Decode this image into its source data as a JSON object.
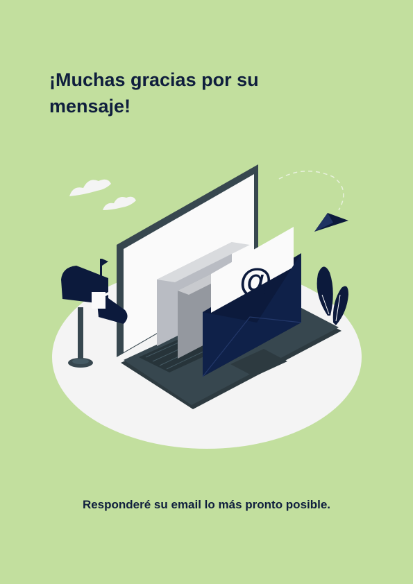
{
  "title": "¡Muchas gracias por su mensaje!",
  "illustration": {
    "at_symbol": "@",
    "icons": [
      "cloud-icon",
      "paper-plane-icon",
      "mailbox-icon",
      "laptop-icon",
      "envelope-icon",
      "plant-icon"
    ]
  },
  "footer": "Responderé su email lo más pronto posible.",
  "colors": {
    "background": "#c2df9e",
    "text": "#0f1e3d",
    "navy": "#0c1a3c",
    "laptop": "#37474f",
    "platform": "#f4f4f4"
  }
}
